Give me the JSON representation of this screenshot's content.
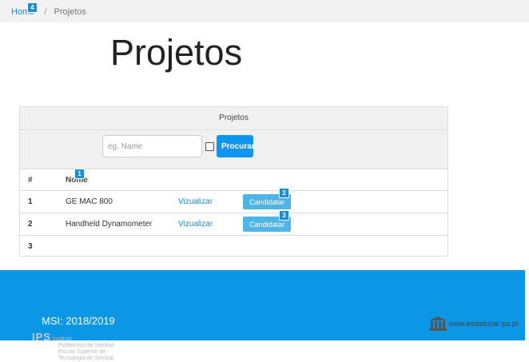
{
  "breadcrumb": {
    "home": "Home",
    "separator": "/",
    "current": "Projetos"
  },
  "page_title": "Projetos",
  "panel": {
    "title": "Projetos",
    "search_placeholder": "eg. Name",
    "search_button": "Procurar"
  },
  "table": {
    "headers": [
      "#",
      "Nome"
    ],
    "rows": [
      {
        "num": "1",
        "name": "GE MAC 800",
        "view": "Vizualizar",
        "apply": "Candidatar"
      },
      {
        "num": "2",
        "name": "Handheld Dynamometer",
        "view": "Vizualizar",
        "apply": "Candidatar"
      },
      {
        "num": "3",
        "name": "",
        "view": "",
        "apply": ""
      }
    ]
  },
  "badges": {
    "home": "4",
    "nome": "1",
    "apply1": "2",
    "apply2": "3"
  },
  "footer": {
    "year": "MSI: 2018/2019",
    "site": "www.estsetubal.ips.pt",
    "logo_lines": [
      "IPS",
      "Instituto",
      "Politécnico de Setúbal",
      "Escola Superior de",
      "Tecnologia de Setúbal"
    ]
  },
  "colors": {
    "accent": "#0c96e6",
    "link": "#1a8cd8",
    "button": "#4fb5e8"
  }
}
